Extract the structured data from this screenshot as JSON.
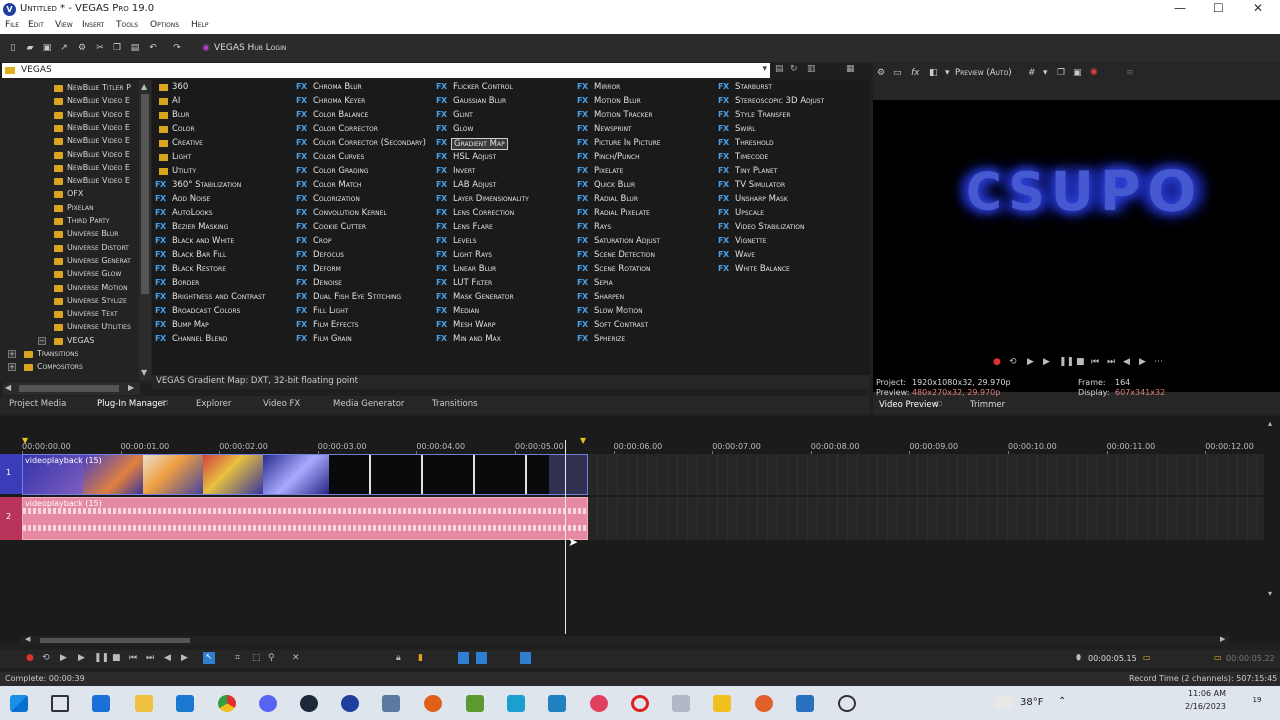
{
  "window": {
    "title": "Untitled * - VEGAS Pro 19.0",
    "logo": "V",
    "minimize": "—",
    "maximize": "☐",
    "close": "✕"
  },
  "menu": [
    "File",
    "Edit",
    "View",
    "Insert",
    "Tools",
    "Options",
    "Help"
  ],
  "toolbar": {
    "hub_label": "VEGAS Hub Login",
    "hub_icon": "hub-icon"
  },
  "path": {
    "text": "VEGAS"
  },
  "tree": [
    {
      "label": "NewBlue Titler P",
      "indent": 1
    },
    {
      "label": "NewBlue Video E",
      "indent": 1
    },
    {
      "label": "NewBlue Video E",
      "indent": 1
    },
    {
      "label": "NewBlue Video E",
      "indent": 1
    },
    {
      "label": "NewBlue Video E",
      "indent": 1
    },
    {
      "label": "NewBlue Video E",
      "indent": 1
    },
    {
      "label": "NewBlue Video E",
      "indent": 1
    },
    {
      "label": "NewBlue Video E",
      "indent": 1
    },
    {
      "label": "OFX",
      "indent": 1
    },
    {
      "label": "Pixelan",
      "indent": 1
    },
    {
      "label": "Third Party",
      "indent": 1
    },
    {
      "label": "Universe Blur",
      "indent": 1
    },
    {
      "label": "Universe Distort",
      "indent": 1
    },
    {
      "label": "Universe Generat",
      "indent": 1
    },
    {
      "label": "Universe Glow",
      "indent": 1
    },
    {
      "label": "Universe Motion",
      "indent": 1
    },
    {
      "label": "Universe Stylize",
      "indent": 1
    },
    {
      "label": "Universe Text",
      "indent": 1
    },
    {
      "label": "Universe Utilities",
      "indent": 1
    },
    {
      "label": "VEGAS",
      "indent": 1,
      "expander": "−"
    },
    {
      "label": "Transitions",
      "indent": 0,
      "expander": "+"
    },
    {
      "label": "Compositors",
      "indent": 0,
      "expander": "+"
    }
  ],
  "fx_columns": [
    [
      {
        "type": "folder",
        "name": "360"
      },
      {
        "type": "folder",
        "name": "AI"
      },
      {
        "type": "folder",
        "name": "Blur"
      },
      {
        "type": "folder",
        "name": "Color"
      },
      {
        "type": "folder",
        "name": "Creative"
      },
      {
        "type": "folder",
        "name": "Light"
      },
      {
        "type": "folder",
        "name": "Utility"
      },
      {
        "type": "fx",
        "name": "360° Stabilization"
      },
      {
        "type": "fx",
        "name": "Add Noise"
      },
      {
        "type": "fx",
        "name": "AutoLooks"
      },
      {
        "type": "fx",
        "name": "Bezier Masking"
      },
      {
        "type": "fx",
        "name": "Black and White"
      },
      {
        "type": "fx",
        "name": "Black Bar Fill"
      },
      {
        "type": "fx",
        "name": "Black Restore"
      },
      {
        "type": "fx",
        "name": "Border"
      },
      {
        "type": "fx",
        "name": "Brightness and Contrast"
      },
      {
        "type": "fx",
        "name": "Broadcast Colors"
      },
      {
        "type": "fx",
        "name": "Bump Map"
      },
      {
        "type": "fx",
        "name": "Channel Blend"
      }
    ],
    [
      {
        "type": "fx",
        "name": "Chroma Blur"
      },
      {
        "type": "fx",
        "name": "Chroma Keyer"
      },
      {
        "type": "fx",
        "name": "Color Balance"
      },
      {
        "type": "fx",
        "name": "Color Corrector"
      },
      {
        "type": "fx",
        "name": "Color Corrector (Secondary)"
      },
      {
        "type": "fx",
        "name": "Color Curves"
      },
      {
        "type": "fx",
        "name": "Color Grading"
      },
      {
        "type": "fx",
        "name": "Color Match"
      },
      {
        "type": "fx",
        "name": "Colorization"
      },
      {
        "type": "fx",
        "name": "Convolution Kernel"
      },
      {
        "type": "fx",
        "name": "Cookie Cutter"
      },
      {
        "type": "fx",
        "name": "Crop"
      },
      {
        "type": "fx",
        "name": "Defocus"
      },
      {
        "type": "fx",
        "name": "Deform"
      },
      {
        "type": "fx",
        "name": "Denoise"
      },
      {
        "type": "fx",
        "name": "Dual Fish Eye Stitching"
      },
      {
        "type": "fx",
        "name": "Fill Light"
      },
      {
        "type": "fx",
        "name": "Film Effects"
      },
      {
        "type": "fx",
        "name": "Film Grain"
      }
    ],
    [
      {
        "type": "fx",
        "name": "Flicker Control"
      },
      {
        "type": "fx",
        "name": "Gaussian Blur"
      },
      {
        "type": "fx",
        "name": "Glint"
      },
      {
        "type": "fx",
        "name": "Glow"
      },
      {
        "type": "fx",
        "name": "Gradient Map",
        "selected": true
      },
      {
        "type": "fx",
        "name": "HSL Adjust"
      },
      {
        "type": "fx",
        "name": "Invert"
      },
      {
        "type": "fx",
        "name": "LAB Adjust"
      },
      {
        "type": "fx",
        "name": "Layer Dimensionality"
      },
      {
        "type": "fx",
        "name": "Lens Correction"
      },
      {
        "type": "fx",
        "name": "Lens Flare"
      },
      {
        "type": "fx",
        "name": "Levels"
      },
      {
        "type": "fx",
        "name": "Light Rays"
      },
      {
        "type": "fx",
        "name": "Linear Blur"
      },
      {
        "type": "fx",
        "name": "LUT Filter"
      },
      {
        "type": "fx",
        "name": "Mask Generator"
      },
      {
        "type": "fx",
        "name": "Median"
      },
      {
        "type": "fx",
        "name": "Mesh Warp"
      },
      {
        "type": "fx",
        "name": "Min and Max"
      }
    ],
    [
      {
        "type": "fx",
        "name": "Mirror"
      },
      {
        "type": "fx",
        "name": "Motion Blur"
      },
      {
        "type": "fx",
        "name": "Motion Tracker"
      },
      {
        "type": "fx",
        "name": "Newsprint"
      },
      {
        "type": "fx",
        "name": "Picture In Picture"
      },
      {
        "type": "fx",
        "name": "Pinch/Punch"
      },
      {
        "type": "fx",
        "name": "Pixelate"
      },
      {
        "type": "fx",
        "name": "Quick Blur"
      },
      {
        "type": "fx",
        "name": "Radial Blur"
      },
      {
        "type": "fx",
        "name": "Radial Pixelate"
      },
      {
        "type": "fx",
        "name": "Rays"
      },
      {
        "type": "fx",
        "name": "Saturation Adjust"
      },
      {
        "type": "fx",
        "name": "Scene Detection"
      },
      {
        "type": "fx",
        "name": "Scene Rotation"
      },
      {
        "type": "fx",
        "name": "Sepia"
      },
      {
        "type": "fx",
        "name": "Sharpen"
      },
      {
        "type": "fx",
        "name": "Slow Motion"
      },
      {
        "type": "fx",
        "name": "Soft Contrast"
      },
      {
        "type": "fx",
        "name": "Spherize"
      }
    ],
    [
      {
        "type": "fx",
        "name": "Starburst"
      },
      {
        "type": "fx",
        "name": "Stereoscopic 3D Adjust"
      },
      {
        "type": "fx",
        "name": "Style Transfer"
      },
      {
        "type": "fx",
        "name": "Swirl"
      },
      {
        "type": "fx",
        "name": "Threshold"
      },
      {
        "type": "fx",
        "name": "Timecode"
      },
      {
        "type": "fx",
        "name": "Tiny Planet"
      },
      {
        "type": "fx",
        "name": "TV Simulator"
      },
      {
        "type": "fx",
        "name": "Unsharp Mask"
      },
      {
        "type": "fx",
        "name": "Upscale"
      },
      {
        "type": "fx",
        "name": "Video Stabilization"
      },
      {
        "type": "fx",
        "name": "Vignette"
      },
      {
        "type": "fx",
        "name": "Wave"
      },
      {
        "type": "fx",
        "name": "White Balance"
      }
    ]
  ],
  "fx_badge": "FX",
  "description": "VEGAS Gradient Map: DXT, 32-bit floating point",
  "left_tabs": [
    "Project Media",
    "Plug-In Manager",
    "Explorer",
    "Video FX",
    "Media Generator",
    "Transitions"
  ],
  "preview": {
    "mode": "Preview (Auto)",
    "screen_text": "CSUPO",
    "project_label": "Project:",
    "project_value": "1920x1080x32, 29.970p",
    "preview_label": "Preview:",
    "preview_value": "480x270x32, 29.970p",
    "frame_label": "Frame:",
    "frame_value": "164",
    "display_label": "Display:",
    "display_value": "607x341x32",
    "tabs": [
      "Video Preview",
      "Trimmer"
    ]
  },
  "timeline": {
    "ruler": [
      "00:00:00.00",
      "00:00:01.00",
      "00:00:02.00",
      "00:00:03.00",
      "00:00:04.00",
      "00:00:05.00",
      "00:00:06.00",
      "00:00:07.00",
      "00:00:08.00",
      "00:00:09.00",
      "00:00:10.00",
      "00:00:11.00",
      "00:00:12.00"
    ],
    "track1": {
      "number": "1",
      "clip": "videoplayback (15)"
    },
    "track2": {
      "number": "2",
      "clip": "videoplayback (15)"
    },
    "cursor_time": "00:00:05.15",
    "right_time": "00:00:05.22"
  },
  "status": {
    "left": "Complete: 00:00:39",
    "right": "Record Time (2 channels): 507:15:45"
  },
  "taskbar": {
    "weather": "38°F",
    "time": "11:06 AM",
    "date": "2/16/2023",
    "notif": "19"
  },
  "colors": {
    "accent": "#1f3f9f",
    "fx_badge": "#4aa0e8",
    "folder": "#d9a520",
    "video_clip": "#2b2d9a",
    "audio_clip": "#e58aa2"
  }
}
